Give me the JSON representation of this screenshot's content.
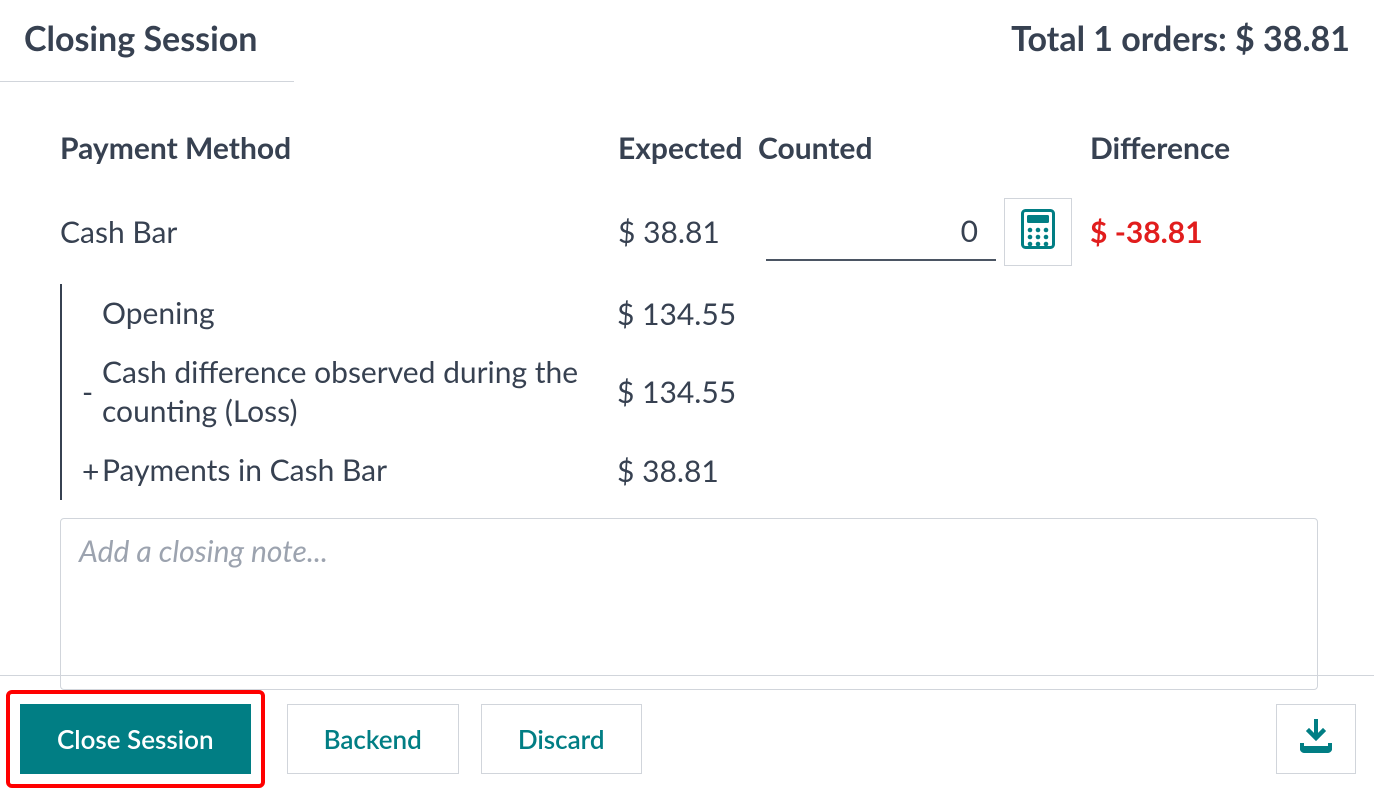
{
  "header": {
    "title": "Closing Session",
    "total_label": "Total 1 orders: $ 38.81"
  },
  "columns": {
    "payment_method": "Payment Method",
    "expected": "Expected",
    "counted": "Counted",
    "difference": "Difference"
  },
  "row": {
    "method": "Cash Bar",
    "expected": "$ 38.81",
    "counted_value": "0",
    "difference": "$ -38.81"
  },
  "breakdown": [
    {
      "sign": "",
      "label": "Opening",
      "amount": "$ 134.55"
    },
    {
      "sign": "-",
      "label": "Cash difference observed during the counting (Loss)",
      "amount": "$ 134.55"
    },
    {
      "sign": "+",
      "label": "Payments in Cash Bar",
      "amount": "$ 38.81"
    }
  ],
  "note_placeholder": "Add a closing note...",
  "buttons": {
    "close_session": "Close Session",
    "backend": "Backend",
    "discard": "Discard"
  }
}
